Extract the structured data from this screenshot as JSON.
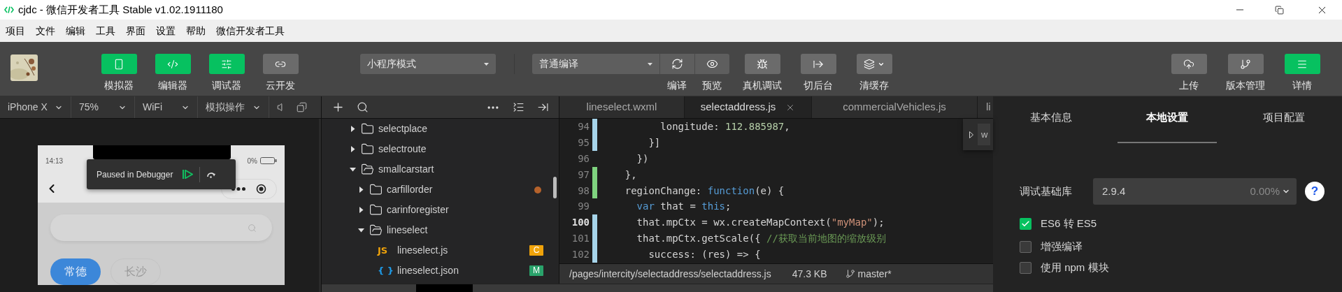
{
  "window": {
    "title": "cjdc - 微信开发者工具 Stable v1.02.1911180"
  },
  "menu": [
    "项目",
    "文件",
    "编辑",
    "工具",
    "界面",
    "设置",
    "帮助",
    "微信开发者工具"
  ],
  "toolbar": {
    "left_buttons": [
      {
        "label": "模拟器",
        "on": true
      },
      {
        "label": "编辑器",
        "on": true
      },
      {
        "label": "调试器",
        "on": true
      },
      {
        "label": "云开发",
        "on": false
      }
    ],
    "mode_select": "小程序模式",
    "compile_select": "普通编译",
    "compile_buttons": [
      {
        "label": "编译"
      },
      {
        "label": "预览"
      }
    ],
    "tool_buttons": [
      {
        "label": "真机调试"
      },
      {
        "label": "切后台"
      },
      {
        "label": "清缓存"
      }
    ],
    "right_buttons": [
      {
        "label": "上传",
        "on": false
      },
      {
        "label": "版本管理",
        "on": false
      },
      {
        "label": "详情",
        "on": true
      }
    ]
  },
  "simulator": {
    "selects": [
      "iPhone X",
      "75%",
      "WiFi",
      "模拟操作"
    ],
    "phone": {
      "time": "14:13",
      "battery": "0%",
      "debugger": "Paused in Debugger",
      "tags": [
        {
          "label": "常德",
          "selected": true
        },
        {
          "label": "长沙",
          "selected": false
        }
      ]
    }
  },
  "file_tree": [
    {
      "kind": "folder",
      "name": "selectplace",
      "expanded": false
    },
    {
      "kind": "folder",
      "name": "selectroute",
      "expanded": false
    },
    {
      "kind": "folder",
      "name": "smallcarstart",
      "expanded": true,
      "children": [
        {
          "kind": "folder",
          "name": "carfillorder",
          "expanded": false,
          "color": "#b5622b"
        },
        {
          "kind": "folder",
          "name": "carinforegister",
          "expanded": false
        },
        {
          "kind": "folder",
          "name": "lineselect",
          "expanded": true,
          "children": [
            {
              "kind": "file",
              "glyph": "JS",
              "name": "lineselect.js",
              "badge": "C",
              "color": "#f0a30a"
            },
            {
              "kind": "file",
              "glyph": "{ }",
              "name": "lineselect.json",
              "badge": "M",
              "color": "#2aa36b"
            }
          ]
        }
      ]
    }
  ],
  "editor": {
    "tabs": [
      {
        "label": "lineselect.wxml",
        "selected": false
      },
      {
        "label": "selectaddress.js",
        "selected": true
      },
      {
        "label": "commercialVehicles.js",
        "selected": false
      },
      {
        "label": "li",
        "selected": false
      }
    ],
    "lines": [
      {
        "number": "94",
        "color": "#a6d4ea",
        "current": false,
        "tokens": [
          {
            "kind": "plain",
            "text": "          longitude: "
          },
          {
            "kind": "number",
            "text": "112.885987"
          },
          {
            "kind": "plain",
            "text": ","
          }
        ]
      },
      {
        "number": "95",
        "color": "#a6d4ea",
        "current": false,
        "tokens": [
          {
            "kind": "plain",
            "text": "        }]"
          }
        ]
      },
      {
        "number": "96",
        "current": false,
        "tokens": [
          {
            "kind": "plain",
            "text": "      })"
          }
        ]
      },
      {
        "number": "97",
        "color": "#7fd37f",
        "current": false,
        "tokens": [
          {
            "kind": "plain",
            "text": "    },"
          }
        ]
      },
      {
        "number": "98",
        "color": "#7fd37f",
        "current": false,
        "tokens": [
          {
            "kind": "plain",
            "text": "    regionChange: "
          },
          {
            "kind": "keyword",
            "text": "function"
          },
          {
            "kind": "plain",
            "text": "(e) {"
          }
        ]
      },
      {
        "number": "99",
        "current": false,
        "tokens": [
          {
            "kind": "keyword",
            "text": "      var"
          },
          {
            "kind": "plain",
            "text": " that = "
          },
          {
            "kind": "keyword",
            "text": "this"
          },
          {
            "kind": "plain",
            "text": ";"
          }
        ]
      },
      {
        "number": "100",
        "color": "#a6d4ea",
        "current": true,
        "tokens": [
          {
            "kind": "plain",
            "text": "      that.mpCtx = wx.createMapContext("
          },
          {
            "kind": "string",
            "text": "\"myMap\""
          },
          {
            "kind": "plain",
            "text": ");"
          }
        ]
      },
      {
        "number": "101",
        "color": "#a6d4ea",
        "current": false,
        "tokens": [
          {
            "kind": "plain",
            "text": "      that.mpCtx.getScale({ "
          },
          {
            "kind": "comment",
            "text": "//获取当前地图的缩放级别"
          }
        ]
      },
      {
        "number": "102",
        "color": "#a6d4ea",
        "current": false,
        "tokens": [
          {
            "kind": "plain",
            "text": "        success: (res) => {"
          }
        ]
      }
    ],
    "peek": "w",
    "status": {
      "path": "/pages/intercity/selectaddress/selectaddress.js",
      "size": "47.3 KB",
      "branch": "master*"
    }
  },
  "details": {
    "tabs": [
      {
        "label": "基本信息",
        "selected": false
      },
      {
        "label": "本地设置",
        "selected": true
      },
      {
        "label": "项目配置",
        "selected": false
      }
    ],
    "base_lib": {
      "label": "调试基础库",
      "value": "2.9.4",
      "share": "0.00%",
      "help": "?"
    },
    "options": [
      {
        "label": "ES6 转 ES5",
        "checked": true
      },
      {
        "label": "增强编译",
        "checked": false
      },
      {
        "label": "使用 npm 模块",
        "checked": false
      }
    ]
  }
}
